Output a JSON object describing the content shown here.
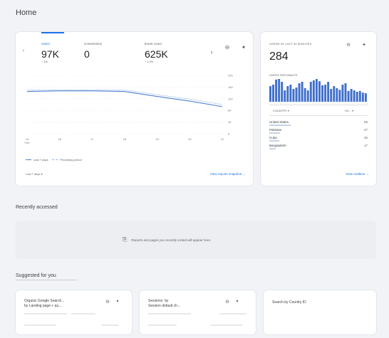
{
  "page": {
    "title": "Home"
  },
  "overview": {
    "tabs": [
      {
        "label": "Users",
        "value": "97K",
        "delta": "↑ 1%"
      },
      {
        "label": "Conversions",
        "value": "0",
        "delta": ""
      },
      {
        "label": "Event count",
        "value": "625K",
        "delta": "↑ 1.4%"
      }
    ],
    "legend": {
      "current": "Last 7 days",
      "previous": "Preceding period"
    },
    "date_range": "Last 7 days",
    "link": "View reports snapshot",
    "chart_data": {
      "type": "line",
      "x": [
        "15",
        "16",
        "17",
        "18",
        "19",
        "20",
        "21"
      ],
      "x_sub": "Feb",
      "ylim": [
        0,
        200
      ],
      "y_ticks": [
        0,
        40,
        80,
        120,
        160,
        200
      ],
      "y_tick_labels": [
        "0",
        "40",
        "80",
        "120",
        "160",
        "200"
      ],
      "series": [
        {
          "name": "Last 7 days",
          "values": [
            145,
            147,
            147,
            145,
            128,
            112,
            93
          ],
          "dashed": false
        },
        {
          "name": "Preceding period",
          "values": [
            150,
            151,
            151,
            150,
            134,
            119,
            100
          ],
          "dashed": true
        }
      ]
    }
  },
  "realtime": {
    "header": "USERS IN LAST 30 MINUTES",
    "count": "284",
    "per_minute_label": "USERS PER MINUTE",
    "bar_values": [
      55,
      60,
      78,
      80,
      70,
      40,
      55,
      60,
      45,
      50,
      65,
      70,
      48,
      40,
      70,
      75,
      80,
      72,
      58,
      60,
      70,
      45,
      55,
      48,
      42,
      60,
      65,
      38,
      45,
      40,
      35,
      38,
      32,
      30
    ],
    "dim_label": "COUNTRY ▾",
    "metric_label": "US... ▾",
    "rows": [
      {
        "name": "United States",
        "count": "55",
        "frac": 1.0
      },
      {
        "name": "Pakistan",
        "count": "27",
        "frac": 0.49
      },
      {
        "name": "Cuba",
        "count": "25",
        "frac": 0.45
      },
      {
        "name": "Bangladesh",
        "count": "17",
        "frac": 0.31
      }
    ],
    "link": "View realtime"
  },
  "recent": {
    "title": "Recently accessed",
    "empty_text": "Reports and pages you recently visited will appear here."
  },
  "suggested": {
    "title": "Suggested for you",
    "cards": [
      {
        "line1": "Organic Google Search...",
        "line2": "by Landing page + qu..."
      },
      {
        "line1": "Sessions  by",
        "line2": "Session default ch..."
      },
      {
        "line1": "Search by Country ID",
        "line2": ""
      }
    ]
  },
  "colors": {
    "accent": "#1a73e8",
    "series_current": "#4a7fd0",
    "series_previous": "#8fb3e8",
    "bars": "#3f6fcb"
  }
}
